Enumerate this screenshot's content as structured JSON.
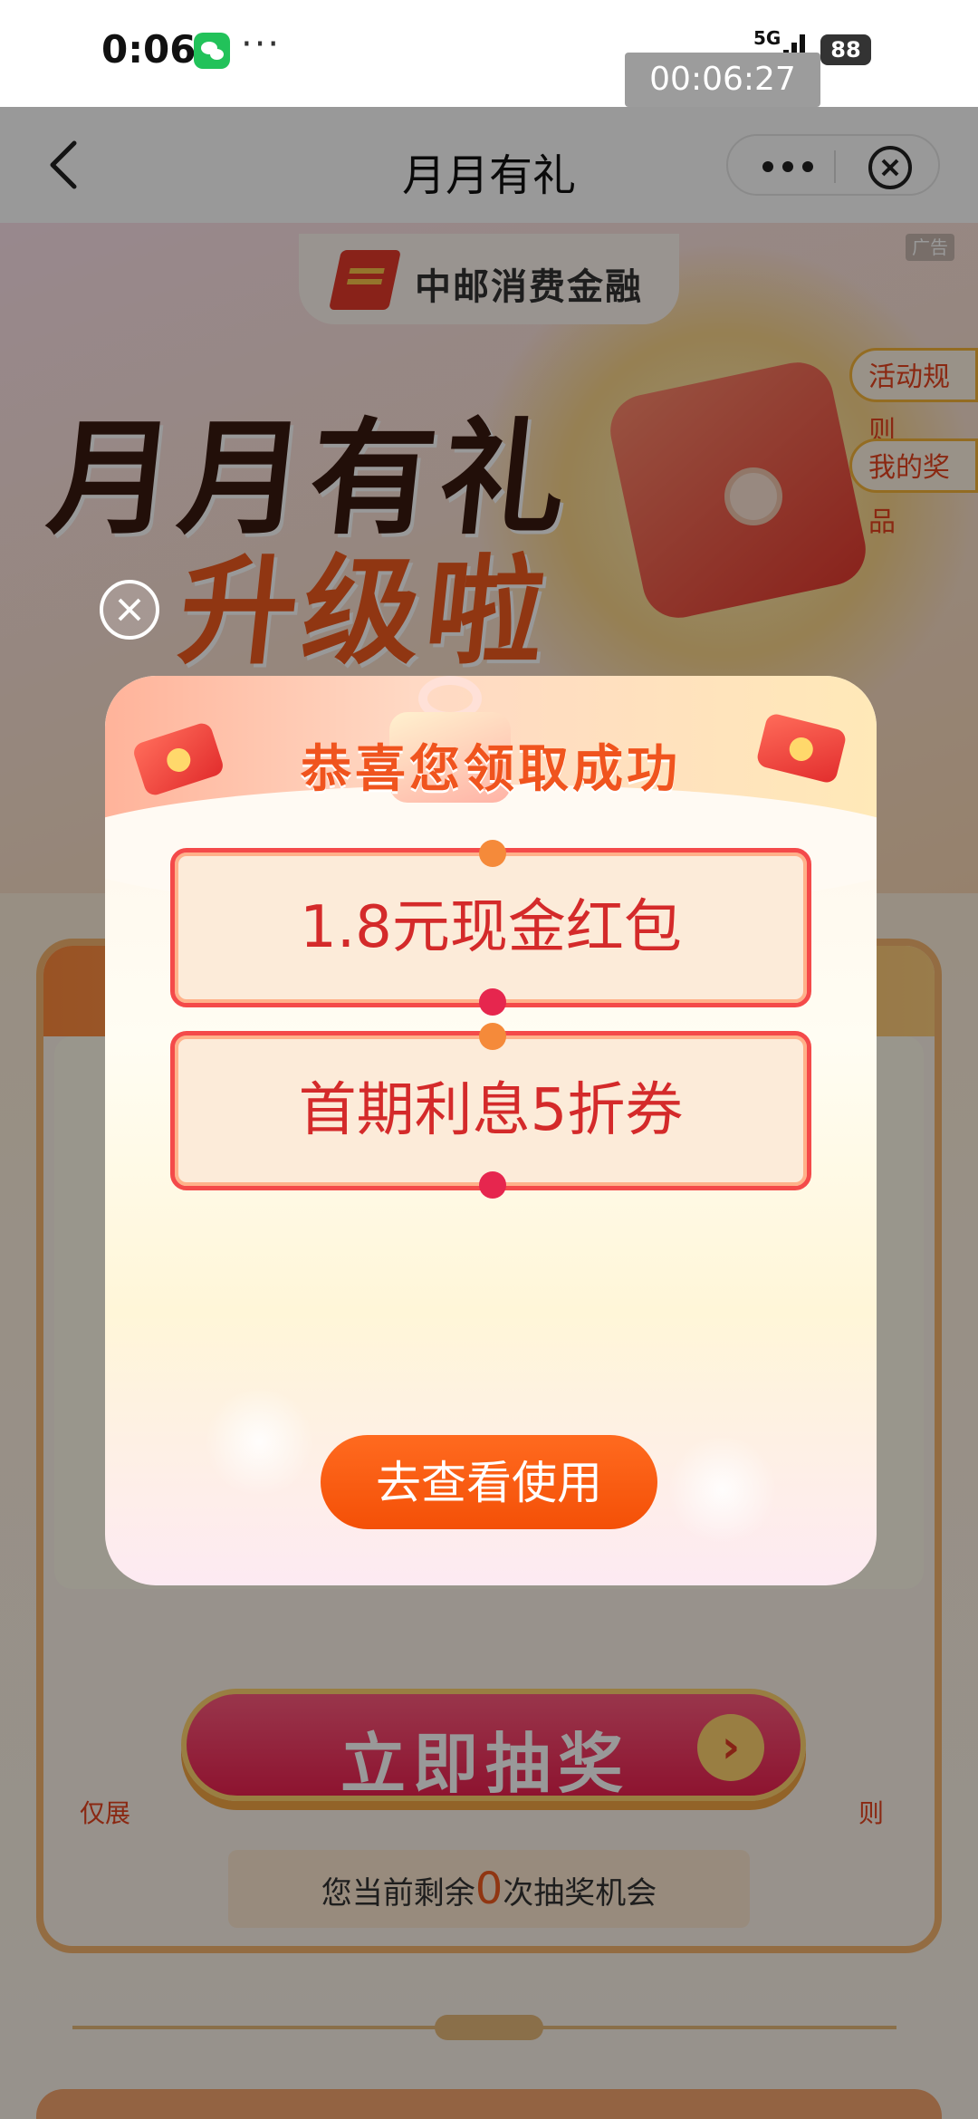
{
  "status_bar": {
    "time": "0:06",
    "network": "5G",
    "battery": "88",
    "recording_timer": "00:06:27"
  },
  "nav": {
    "title": "月月有礼"
  },
  "banner": {
    "brand": "中邮消费金融",
    "ad_tag": "广告",
    "headline": "月月有礼",
    "subheadline": "升级啦",
    "rules_button": "活动规则",
    "prizes_button": "我的奖品"
  },
  "lottery": {
    "draw_button": "立即抽奖",
    "chance_prefix": "您当前剩余",
    "chance_count": "0",
    "chance_suffix": "次抽奖机会",
    "note_left": "仅展",
    "note_right": "则"
  },
  "popup": {
    "title": "恭喜您领取成功",
    "rewards": [
      "1.8元现金红包",
      "首期利息5折券"
    ],
    "action_button": "去查看使用"
  },
  "colors": {
    "accent": "#f45007",
    "coupon_border": "#f44a4a",
    "coupon_text": "#d42a2a"
  }
}
